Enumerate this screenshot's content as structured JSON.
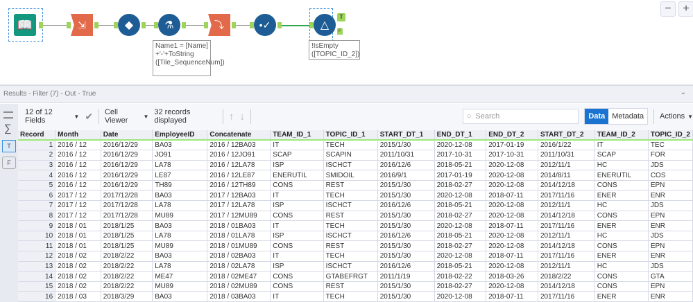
{
  "canvas": {
    "formula_note": "Name1 = [Name] +'-'+ToString ([Tile_SequenceNum])",
    "filter_note": "!IsEmpty ([TOPIC_ID_2])",
    "filter_true_anchor": "T",
    "filter_false_anchor": "F",
    "zoom_out": "−",
    "zoom_in": "+"
  },
  "results": {
    "title": "Results - Filter (7) - Out - True",
    "collapse": "⌄"
  },
  "toolbar": {
    "fields": "12 of 12 Fields",
    "viewer": "Cell Viewer",
    "records": "32 records displayed",
    "search_placeholder": "Search",
    "data_tab": "Data",
    "metadata_tab": "Metadata",
    "actions": "Actions"
  },
  "sidebar": {
    "true_anchor": "T",
    "false_anchor": "F"
  },
  "table": {
    "columns": [
      "Record",
      "Month",
      "Date",
      "EmployeeID",
      "Concatenate",
      "TEAM_ID_1",
      "TOPIC_ID_1",
      "START_DT_1",
      "END_DT_1",
      "END_DT_2",
      "START_DT_2",
      "TEAM_ID_2",
      "TOPIC_ID_2"
    ],
    "rows": [
      [
        "1",
        "2016 / 12",
        "2016/12/29",
        "BA03",
        "2016 / 12BA03",
        "IT",
        "TECH",
        "2015/1/30",
        "2020-12-08",
        "2017-01-19",
        "2016/1/22",
        "IT",
        "TEC"
      ],
      [
        "2",
        "2016 / 12",
        "2016/12/29",
        "JO91",
        "2016 / 12JO91",
        "SCAP",
        "SCAPIN",
        "2011/10/31",
        "2017-10-31",
        "2017-10-31",
        "2011/10/31",
        "SCAP",
        "FOR"
      ],
      [
        "3",
        "2016 / 12",
        "2016/12/29",
        "LA78",
        "2016 / 12LA78",
        "ISP",
        "ISCHCT",
        "2016/12/6",
        "2018-05-21",
        "2020-12-08",
        "2012/11/1",
        "HC",
        "JDS"
      ],
      [
        "4",
        "2016 / 12",
        "2016/12/29",
        "LE87",
        "2016 / 12LE87",
        "ENERUTIL",
        "SMIDOIL",
        "2016/9/1",
        "2017-01-19",
        "2020-12-08",
        "2014/8/11",
        "ENERUTIL",
        "COS"
      ],
      [
        "5",
        "2016 / 12",
        "2016/12/29",
        "TH89",
        "2016 / 12TH89",
        "CONS",
        "REST",
        "2015/1/30",
        "2018-02-27",
        "2020-12-08",
        "2014/12/18",
        "CONS",
        "EPN"
      ],
      [
        "6",
        "2017 / 12",
        "2017/12/28",
        "BA03",
        "2017 / 12BA03",
        "IT",
        "TECH",
        "2015/1/30",
        "2020-12-08",
        "2018-07-11",
        "2017/11/16",
        "ENER",
        "ENR"
      ],
      [
        "7",
        "2017 / 12",
        "2017/12/28",
        "LA78",
        "2017 / 12LA78",
        "ISP",
        "ISCHCT",
        "2016/12/6",
        "2018-05-21",
        "2020-12-08",
        "2012/11/1",
        "HC",
        "JDS"
      ],
      [
        "8",
        "2017 / 12",
        "2017/12/28",
        "MU89",
        "2017 / 12MU89",
        "CONS",
        "REST",
        "2015/1/30",
        "2018-02-27",
        "2020-12-08",
        "2014/12/18",
        "CONS",
        "EPN"
      ],
      [
        "9",
        "2018 / 01",
        "2018/1/25",
        "BA03",
        "2018 / 01BA03",
        "IT",
        "TECH",
        "2015/1/30",
        "2020-12-08",
        "2018-07-11",
        "2017/11/16",
        "ENER",
        "ENR"
      ],
      [
        "10",
        "2018 / 01",
        "2018/1/25",
        "LA78",
        "2018 / 01LA78",
        "ISP",
        "ISCHCT",
        "2016/12/6",
        "2018-05-21",
        "2020-12-08",
        "2012/11/1",
        "HC",
        "JDS"
      ],
      [
        "11",
        "2018 / 01",
        "2018/1/25",
        "MU89",
        "2018 / 01MU89",
        "CONS",
        "REST",
        "2015/1/30",
        "2018-02-27",
        "2020-12-08",
        "2014/12/18",
        "CONS",
        "EPN"
      ],
      [
        "12",
        "2018 / 02",
        "2018/2/22",
        "BA03",
        "2018 / 02BA03",
        "IT",
        "TECH",
        "2015/1/30",
        "2020-12-08",
        "2018-07-11",
        "2017/11/16",
        "ENER",
        "ENR"
      ],
      [
        "13",
        "2018 / 02",
        "2018/2/22",
        "LA78",
        "2018 / 02LA78",
        "ISP",
        "ISCHCT",
        "2016/12/6",
        "2018-05-21",
        "2020-12-08",
        "2012/11/1",
        "HC",
        "JDS"
      ],
      [
        "14",
        "2018 / 02",
        "2018/2/22",
        "ME47",
        "2018 / 02ME47",
        "CONS",
        "GTABEFRGT",
        "2011/1/19",
        "2018-02-22",
        "2018-03-26",
        "2018/2/22",
        "CONS",
        "GTA"
      ],
      [
        "15",
        "2018 / 02",
        "2018/2/22",
        "MU89",
        "2018 / 02MU89",
        "CONS",
        "REST",
        "2015/1/30",
        "2018-02-27",
        "2020-12-08",
        "2014/12/18",
        "CONS",
        "EPN"
      ],
      [
        "16",
        "2018 / 03",
        "2018/3/29",
        "BA03",
        "2018 / 03BA03",
        "IT",
        "TECH",
        "2015/1/30",
        "2020-12-08",
        "2018-07-11",
        "2017/11/16",
        "ENER",
        "ENR"
      ]
    ]
  }
}
